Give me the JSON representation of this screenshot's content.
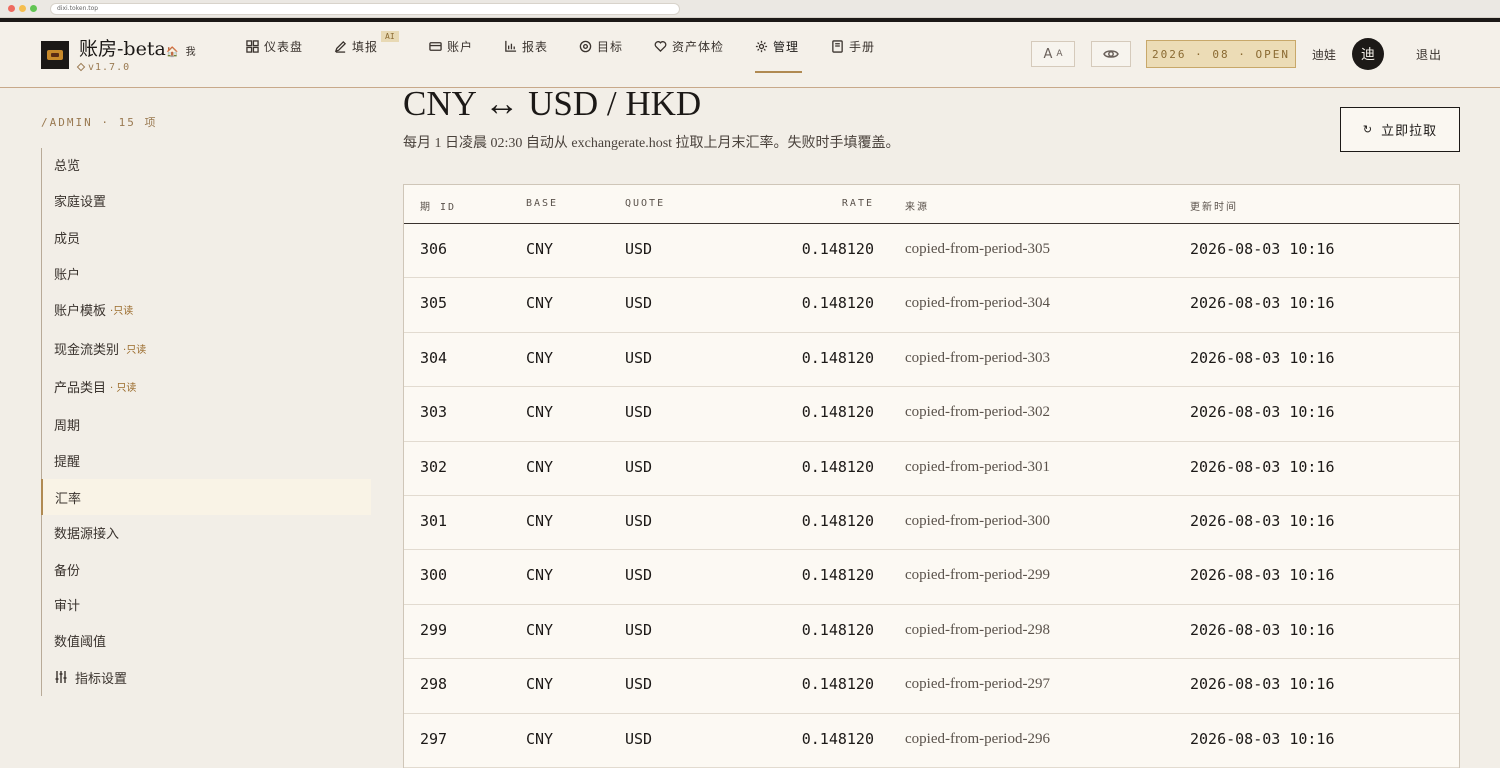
{
  "browser": {
    "url": "dixi.token.top"
  },
  "header": {
    "brand": "账房-beta",
    "brand_sub": "🏠 我",
    "version": "v1.7.0",
    "nav": [
      {
        "label": "仪表盘",
        "icon": "grid-icon"
      },
      {
        "label": "填报",
        "icon": "pen-icon",
        "badge": "AI"
      },
      {
        "label": "账户",
        "icon": "card-icon"
      },
      {
        "label": "报表",
        "icon": "bar-chart-icon"
      },
      {
        "label": "目标",
        "icon": "target-icon"
      },
      {
        "label": "资产体检",
        "icon": "heart-icon"
      },
      {
        "label": "管理",
        "icon": "gear-icon",
        "active": true
      },
      {
        "label": "手册",
        "icon": "book-icon"
      }
    ],
    "font_btn_big": "A",
    "font_btn_small": "A",
    "period": "2026 · 08 · OPEN",
    "username": "迪娃",
    "avatar": "迪",
    "logout": "退出"
  },
  "sidebar": {
    "title": "/ADMIN · 15 项",
    "items": [
      {
        "label": "总览"
      },
      {
        "label": "家庭设置"
      },
      {
        "label": "成员"
      },
      {
        "label": "账户"
      },
      {
        "label": "账户模板",
        "readonly": "·只读"
      },
      {
        "label": "现金流类别",
        "readonly": "·只读"
      },
      {
        "label": "产品类目",
        "readonly": "· 只读"
      },
      {
        "label": "周期"
      },
      {
        "label": "提醒"
      },
      {
        "label": "汇率",
        "active": true
      },
      {
        "label": "数据源接入"
      },
      {
        "label": "备份"
      },
      {
        "label": "审计"
      },
      {
        "label": "数值阈值"
      },
      {
        "label": "指标设置",
        "icon": "sliders-icon"
      }
    ]
  },
  "main": {
    "title": "CNY ↔ USD / HKD",
    "description": "每月 1 日凌晨 02:30 自动从 exchangerate.host 拉取上月末汇率。失败时手填覆盖。",
    "fetch_button": "立即拉取",
    "fetch_icon": "↻",
    "table": {
      "headers": [
        "期 ID",
        "BASE",
        "QUOTE",
        "RATE",
        "来源",
        "更新时间"
      ],
      "rows": [
        [
          "306",
          "CNY",
          "USD",
          "0.148120",
          "copied-from-period-305",
          "2026-08-03 10:16"
        ],
        [
          "305",
          "CNY",
          "USD",
          "0.148120",
          "copied-from-period-304",
          "2026-08-03 10:16"
        ],
        [
          "304",
          "CNY",
          "USD",
          "0.148120",
          "copied-from-period-303",
          "2026-08-03 10:16"
        ],
        [
          "303",
          "CNY",
          "USD",
          "0.148120",
          "copied-from-period-302",
          "2026-08-03 10:16"
        ],
        [
          "302",
          "CNY",
          "USD",
          "0.148120",
          "copied-from-period-301",
          "2026-08-03 10:16"
        ],
        [
          "301",
          "CNY",
          "USD",
          "0.148120",
          "copied-from-period-300",
          "2026-08-03 10:16"
        ],
        [
          "300",
          "CNY",
          "USD",
          "0.148120",
          "copied-from-period-299",
          "2026-08-03 10:16"
        ],
        [
          "299",
          "CNY",
          "USD",
          "0.148120",
          "copied-from-period-298",
          "2026-08-03 10:16"
        ],
        [
          "298",
          "CNY",
          "USD",
          "0.148120",
          "copied-from-period-297",
          "2026-08-03 10:16"
        ],
        [
          "297",
          "CNY",
          "USD",
          "0.148120",
          "copied-from-period-296",
          "2026-08-03 10:16"
        ]
      ]
    }
  },
  "colors": {
    "accent": "#b08a52",
    "ink": "#1c1917",
    "period_bg": "#ecdcb6"
  }
}
